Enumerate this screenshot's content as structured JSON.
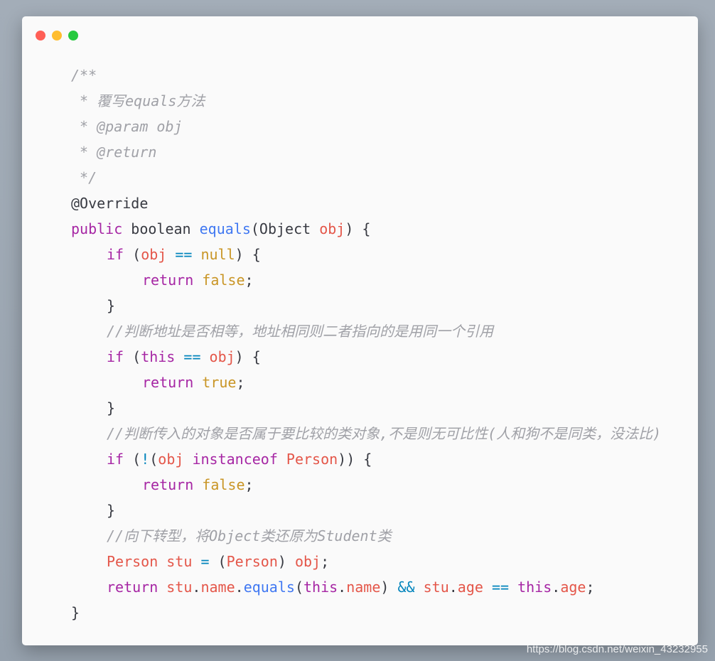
{
  "window": {
    "controls": [
      {
        "name": "close",
        "color": "#ff5f56"
      },
      {
        "name": "minimize",
        "color": "#ffbd2e"
      },
      {
        "name": "maximize",
        "color": "#27c93f"
      }
    ]
  },
  "code": {
    "l1": "/**",
    "l2": " * 覆写equals方法",
    "l3": " * @param obj",
    "l4": " * @return",
    "l5": " */",
    "l6": "@Override",
    "l7": {
      "kw": "public",
      "t1": " boolean ",
      "fn": "equals",
      "t2": "(Object ",
      "v": "obj",
      "t3": ") {"
    },
    "l8": {
      "kw": "if",
      "t1": " (",
      "v": "obj",
      "sp1": " ",
      "op": "==",
      "sp2": " ",
      "lit": "null",
      "t2": ") {"
    },
    "l9": {
      "kw": "return",
      "sp": " ",
      "lit": "false",
      "t": ";"
    },
    "l10": "}",
    "l11": "//判断地址是否相等，地址相同则二者指向的是用同一个引用",
    "l12": {
      "kw": "if",
      "t1": " (",
      "kw2": "this",
      "sp1": " ",
      "op": "==",
      "sp2": " ",
      "v": "obj",
      "t2": ") {"
    },
    "l13": {
      "kw": "return",
      "sp": " ",
      "lit": "true",
      "t": ";"
    },
    "l14": "}",
    "l15": "//判断传入的对象是否属于要比较的类对象,不是则无可比性(人和狗不是同类，没法比)",
    "l16": {
      "kw": "if",
      "t1": " (",
      "op": "!",
      "t2": "(",
      "v": "obj",
      "sp1": " ",
      "kw2": "instanceof",
      "sp2": " ",
      "ty": "Person",
      "t3": ")) {"
    },
    "l17": {
      "kw": "return",
      "sp": " ",
      "lit": "false",
      "t": ";"
    },
    "l18": "}",
    "l19": "//向下转型，将Object类还原为Student类",
    "l20": {
      "ty": "Person",
      "sp1": " ",
      "v": "stu",
      "sp2": " ",
      "op": "=",
      "t1": " (",
      "ty2": "Person",
      "t2": ") ",
      "v2": "obj",
      "t3": ";"
    },
    "l21": {
      "kw": "return",
      "sp1": " ",
      "v1": "stu",
      "d1": ".",
      "v2": "name",
      "d2": ".",
      "fn": "equals",
      "p1": "(",
      "kw2": "this",
      "d3": ".",
      "v3": "name",
      "p2": ") ",
      "op1": "&&",
      "sp2": " ",
      "v4": "stu",
      "d4": ".",
      "v5": "age",
      "sp3": " ",
      "op2": "==",
      "sp4": " ",
      "kw3": "this",
      "d5": ".",
      "v6": "age",
      "t": ";"
    },
    "l22": "}"
  },
  "watermark": "https://blog.csdn.net/weixin_43232955"
}
